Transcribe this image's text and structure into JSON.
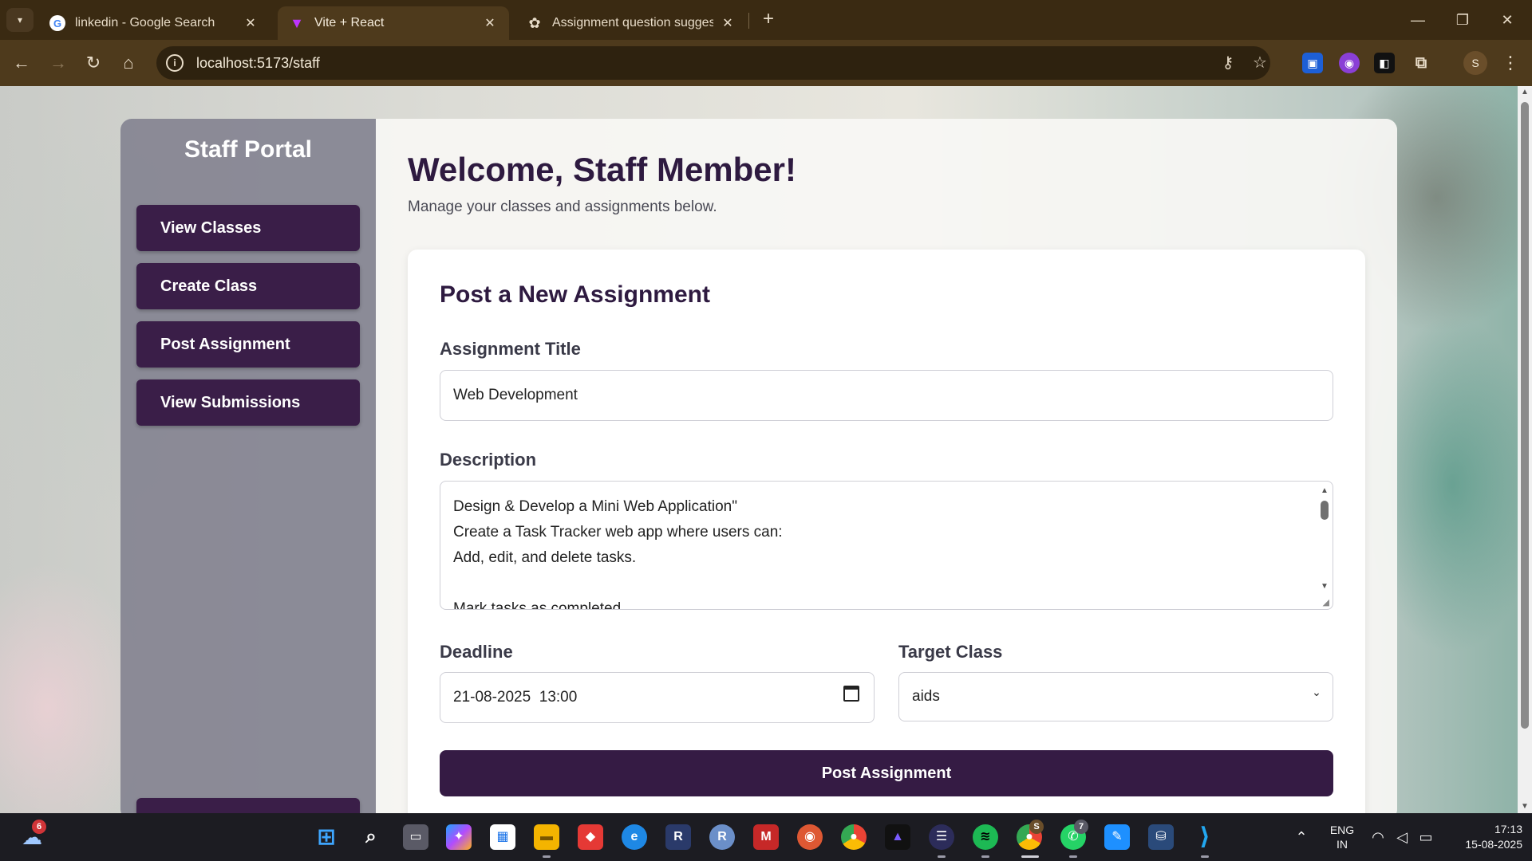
{
  "browser": {
    "tabs": [
      {
        "title": "linkedin - Google Search",
        "favicon": "google-icon"
      },
      {
        "title": "Vite + React",
        "favicon": "vite-icon"
      },
      {
        "title": "Assignment question suggestio",
        "favicon": "openai-icon"
      }
    ],
    "url": "localhost:5173/staff",
    "profile_initial": "S"
  },
  "sidebar": {
    "brand": "Staff Portal",
    "items": [
      {
        "label": "View Classes"
      },
      {
        "label": "Create Class"
      },
      {
        "label": "Post Assignment"
      },
      {
        "label": "View Submissions"
      }
    ]
  },
  "main": {
    "welcome": "Welcome, Staff Member!",
    "subtitle": "Manage your classes and assignments below."
  },
  "form": {
    "heading": "Post a New Assignment",
    "title_label": "Assignment Title",
    "title_value": "Web Development",
    "description_label": "Description",
    "description_lines": [
      "Design & Develop a Mini Web Application\"",
      "Create a Task Tracker web app where users can:",
      "Add, edit, and delete tasks.",
      "",
      "Mark tasks as completed."
    ],
    "deadline_label": "Deadline",
    "deadline_value": "21-08-2025  13:00",
    "target_label": "Target Class",
    "target_value": "aids",
    "submit_label": "Post Assignment"
  },
  "taskbar": {
    "weather_badge": "6",
    "whatsapp_badge": "7",
    "chrome_badge": "S",
    "lang": "ENG",
    "region": "IN",
    "time": "17:13",
    "date": "15-08-2025"
  },
  "colors": {
    "primary": "#351b44",
    "heading": "#2e1a40",
    "chrome_bg": "#4e3a1c"
  }
}
